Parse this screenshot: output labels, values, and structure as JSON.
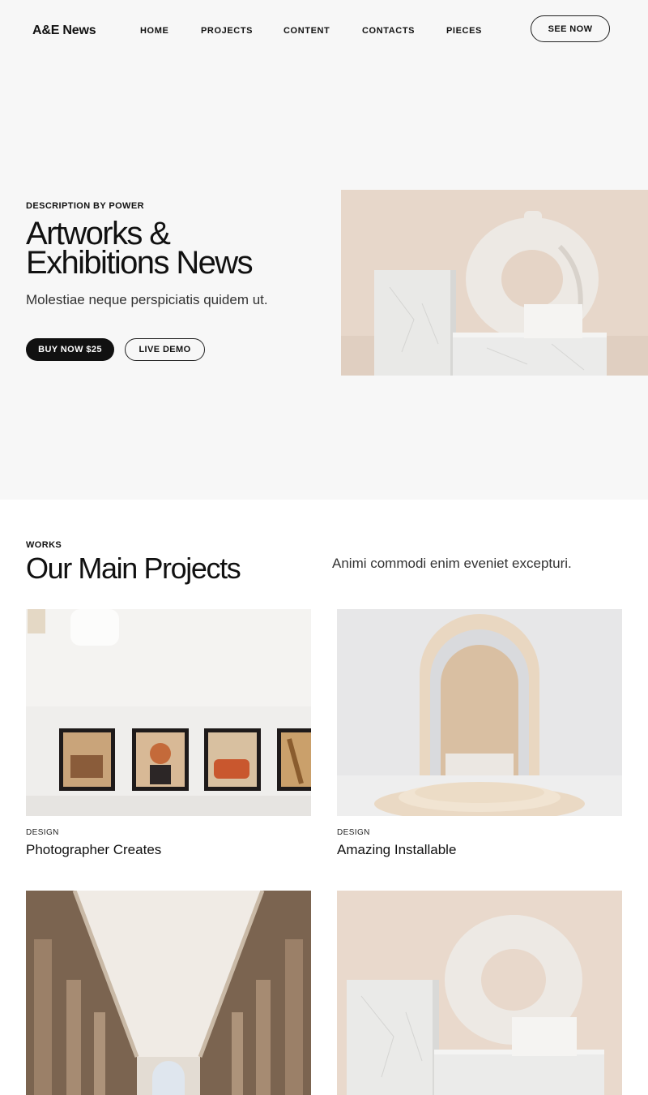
{
  "header": {
    "logo": "A&E News",
    "nav": [
      "HOME",
      "PROJECTS",
      "CONTENT",
      "CONTACTS",
      "PIECES"
    ],
    "cta": "SEE NOW"
  },
  "hero": {
    "eyebrow": "DESCRIPTION BY POWER",
    "title_line1": "Artworks &",
    "title_line2": "Exhibitions News",
    "subtitle": "Molestiae neque perspiciatis quidem ut.",
    "primary_button": "BUY NOW $25",
    "secondary_button": "LIVE DEMO"
  },
  "projects": {
    "eyebrow": "WORKS",
    "title": "Our Main Projects",
    "description": "Animi commodi enim eveniet excepturi.",
    "cards": [
      {
        "tag": "DESIGN",
        "title": "Photographer Creates"
      },
      {
        "tag": "DESIGN",
        "title": "Amazing Installable"
      }
    ]
  }
}
